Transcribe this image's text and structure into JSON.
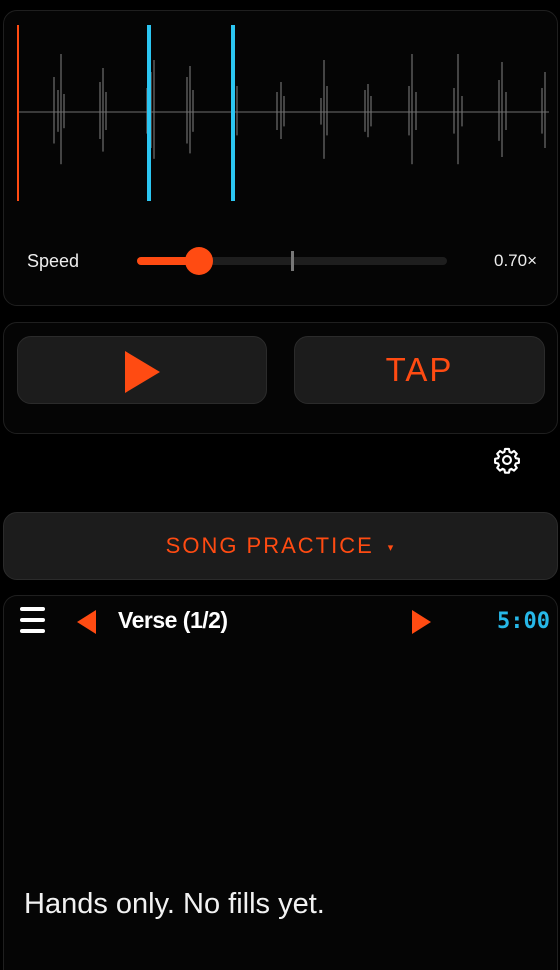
{
  "colors": {
    "accent": "#ff4b12",
    "marker": "#2cc6f2",
    "waveform": "#6f6f6f",
    "timer": "#27b8e8"
  },
  "waveform": {
    "playhead_color": "#ff4b12",
    "loop_marker_color": "#2cc6f2"
  },
  "speed": {
    "label": "Speed",
    "value_text": "0.70×",
    "fraction": 0.2,
    "default_tick_fraction": 0.5
  },
  "transport": {
    "play_icon": "play-icon",
    "tap_label": "TAP"
  },
  "settings": {
    "icon": "gear-icon"
  },
  "mode": {
    "label": "SONG PRACTICE",
    "caret": "▾"
  },
  "section": {
    "menu_icon": "hamburger-icon",
    "title": "Verse (1/2)",
    "timer": "5:00",
    "note": "Hands only. No fills yet."
  }
}
